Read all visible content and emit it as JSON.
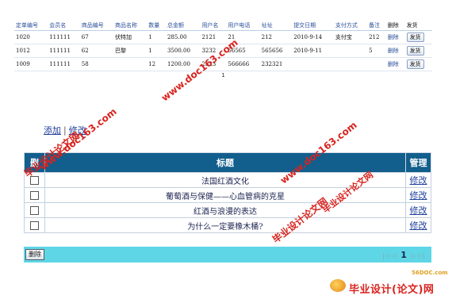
{
  "orders": {
    "headers": [
      "定单编号",
      "会员名",
      "商品编号",
      "商品名称",
      "数量",
      "总金额",
      "用户名",
      "用户电话",
      "址址",
      "提交日期",
      "支付方式",
      "备注",
      "删除",
      "发货"
    ],
    "rows": [
      {
        "id": "1020",
        "member": "111111",
        "pid": "67",
        "pname": "伏特加",
        "qty": "1",
        "total": "285.00",
        "user": "2121",
        "phone": "21",
        "addr": "212",
        "date": "2010-9-14",
        "pay": "支付宝",
        "note": "212",
        "del": "删除",
        "send": "发货"
      },
      {
        "id": "1012",
        "member": "111111",
        "pid": "62",
        "pname": "巴黎",
        "qty": "1",
        "total": "3500.00",
        "user": "3232",
        "phone": "56565",
        "addr": "565656",
        "date": "2010-9-11",
        "pay": "",
        "note": "5",
        "del": "删除",
        "send": "发货"
      },
      {
        "id": "1009",
        "member": "111111",
        "pid": "58",
        "pname": "",
        "qty": "12",
        "total": "1200.00",
        "user": "2323",
        "phone": "566666",
        "addr": "232321",
        "date": "",
        "pay": "",
        "note": "",
        "del": "删除",
        "send": "发货"
      }
    ],
    "page": "1"
  },
  "links": {
    "add": "添加",
    "sep": "|",
    "edit": "修改"
  },
  "articles": {
    "headers": {
      "select": "删",
      "title": "标题",
      "manage": "管理"
    },
    "rows": [
      {
        "title": "法国红酒文化",
        "action": "修改"
      },
      {
        "title": "葡萄酒与保健——心血管病的克星",
        "action": "修改"
      },
      {
        "title": "红酒与浪漫的表达",
        "action": "修改"
      },
      {
        "title": "为什么一定要橡木桶?",
        "action": "修改"
      }
    ]
  },
  "footer": {
    "delete_label": "删除",
    "first": "|◁",
    "prev": "◁",
    "page": "1",
    "next": "▷",
    "last": "▷|"
  },
  "watermarks": {
    "w1": "www.doc163.com",
    "w2": "毕业设计论文网",
    "w3": "www.doc163.com",
    "w4": "毕业设计论文网",
    "w5": "www.doc163.com",
    "w6": "毕业设计论文网"
  },
  "logo": {
    "small": "56DOC.com",
    "main": "毕业设计(论文)网"
  },
  "colors": {
    "header_blue": "#125e8d",
    "bar_cyan": "#5fd6e6",
    "link": "#1f3f9a",
    "watermark": "#d8231e"
  }
}
